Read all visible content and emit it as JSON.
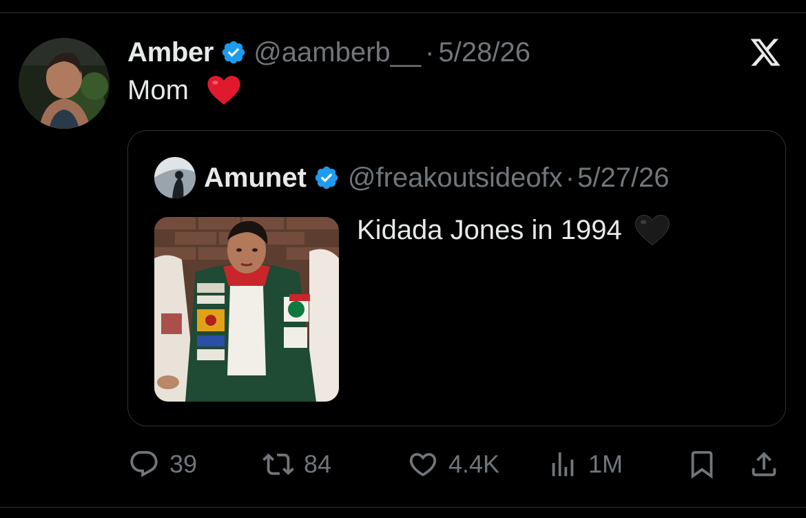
{
  "tweet": {
    "author": {
      "name": "Amber",
      "handle": "@aamberb__",
      "verified": true,
      "avatar_icon": "user-avatar-photo"
    },
    "separator": "·",
    "date": "5/28/26",
    "text": "Mom",
    "emoji": "red-heart-emoji"
  },
  "quoted_tweet": {
    "author": {
      "name": "Amunet",
      "handle": "@freakoutsideofx",
      "verified": true,
      "avatar_icon": "user-avatar-photo"
    },
    "separator": "·",
    "date": "5/27/26",
    "text": "Kidada Jones in 1994",
    "emoji": "black-heart-emoji",
    "media_icon": "photo-thumbnail"
  },
  "actions": {
    "replies": "39",
    "reposts": "84",
    "likes": "4.4K",
    "views": "1M"
  },
  "colors": {
    "background": "#000000",
    "text_primary": "#e7e9ea",
    "text_secondary": "#71767b",
    "verified_blue": "#1d9bf0",
    "border": "#2f3336",
    "heart_red": "#e0192e"
  }
}
